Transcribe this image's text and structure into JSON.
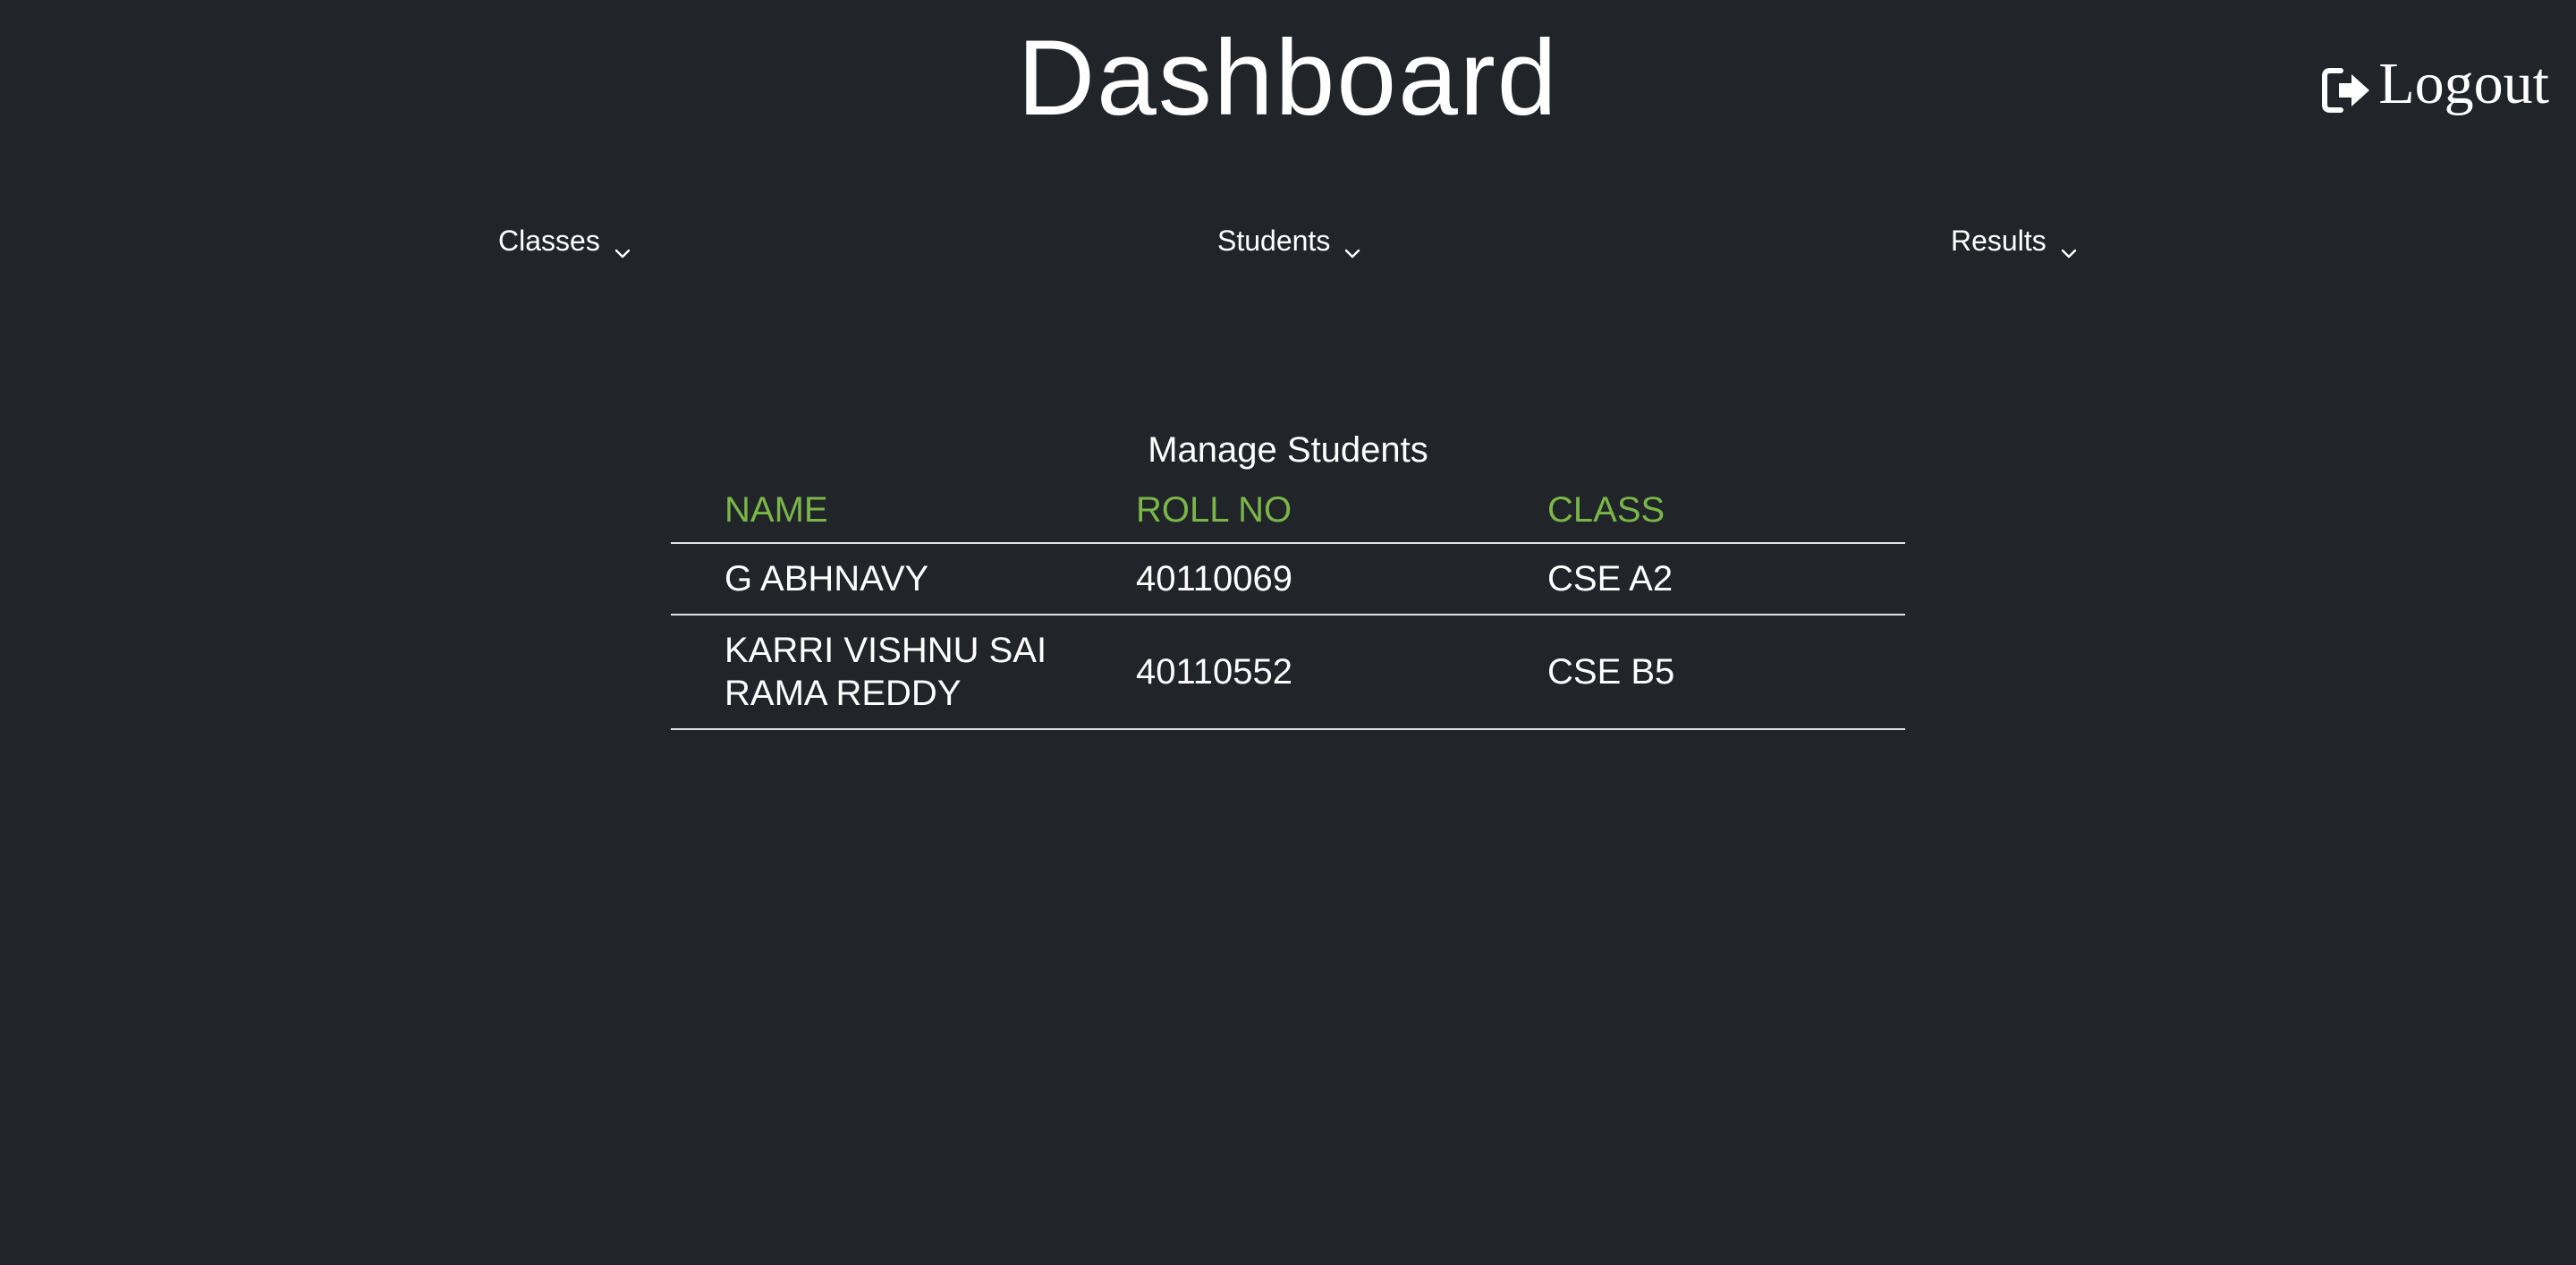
{
  "header": {
    "title": "Dashboard",
    "logout_label": "Logout",
    "logout_icon": "sign-out-icon"
  },
  "nav": {
    "items": [
      {
        "label": "Classes",
        "icon": "chevron-down-icon"
      },
      {
        "label": "Students",
        "icon": "chevron-down-icon"
      },
      {
        "label": "Results",
        "icon": "chevron-down-icon"
      }
    ]
  },
  "main": {
    "section_title": "Manage Students",
    "table": {
      "columns": [
        "NAME",
        "ROLL NO",
        "CLASS"
      ],
      "rows": [
        {
          "name": "G ABHNAVY",
          "roll_no": "40110069",
          "class": "CSE A2"
        },
        {
          "name_line1": "KARRI VISHNU SAI",
          "name_line2": "RAMA REDDY",
          "roll_no": "40110552",
          "class": "CSE B5"
        }
      ]
    }
  },
  "colors": {
    "background": "#212529",
    "header_accent": "#7ab648",
    "text": "#ffffff",
    "divider": "#dee2e6"
  }
}
